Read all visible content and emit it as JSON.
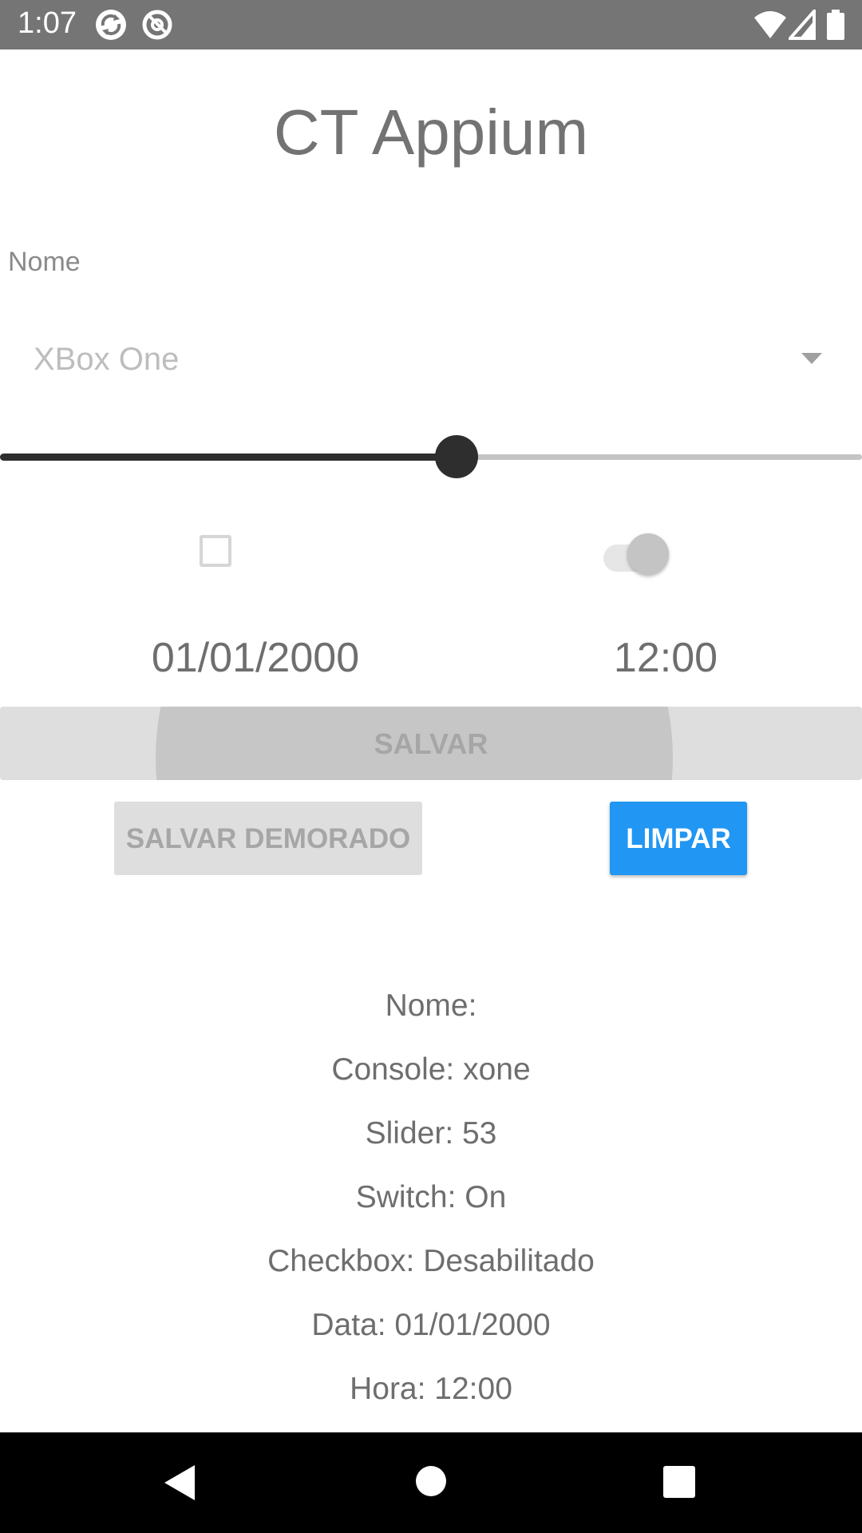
{
  "status_bar": {
    "time": "1:07",
    "left_icons": [
      "sync-icon",
      "at-sign-icon"
    ],
    "right_icons": [
      "wifi-icon",
      "signal-icon",
      "battery-icon"
    ],
    "background_color": "#757575"
  },
  "app": {
    "title": "CT Appium"
  },
  "form": {
    "name_field": {
      "placeholder": "Nome",
      "value": ""
    },
    "console_select": {
      "selected": "XBox One"
    },
    "slider": {
      "value_percent": 53
    },
    "checkbox": {
      "checked": false
    },
    "switch": {
      "on": true
    },
    "date": "01/01/2000",
    "time": "12:00"
  },
  "buttons": {
    "save_label": "SALVAR",
    "save_delayed_label": "SALVAR DEMORADO",
    "clear_label": "LIMPAR",
    "clear_color": "#2196f3"
  },
  "results": [
    "Nome:",
    "Console: xone",
    "Slider: 53",
    "Switch: On",
    "Checkbox: Desabilitado",
    "Data: 01/01/2000",
    "Hora: 12:00"
  ],
  "nav_bar": {
    "icons": [
      "back-icon",
      "home-icon",
      "recents-icon"
    ]
  }
}
